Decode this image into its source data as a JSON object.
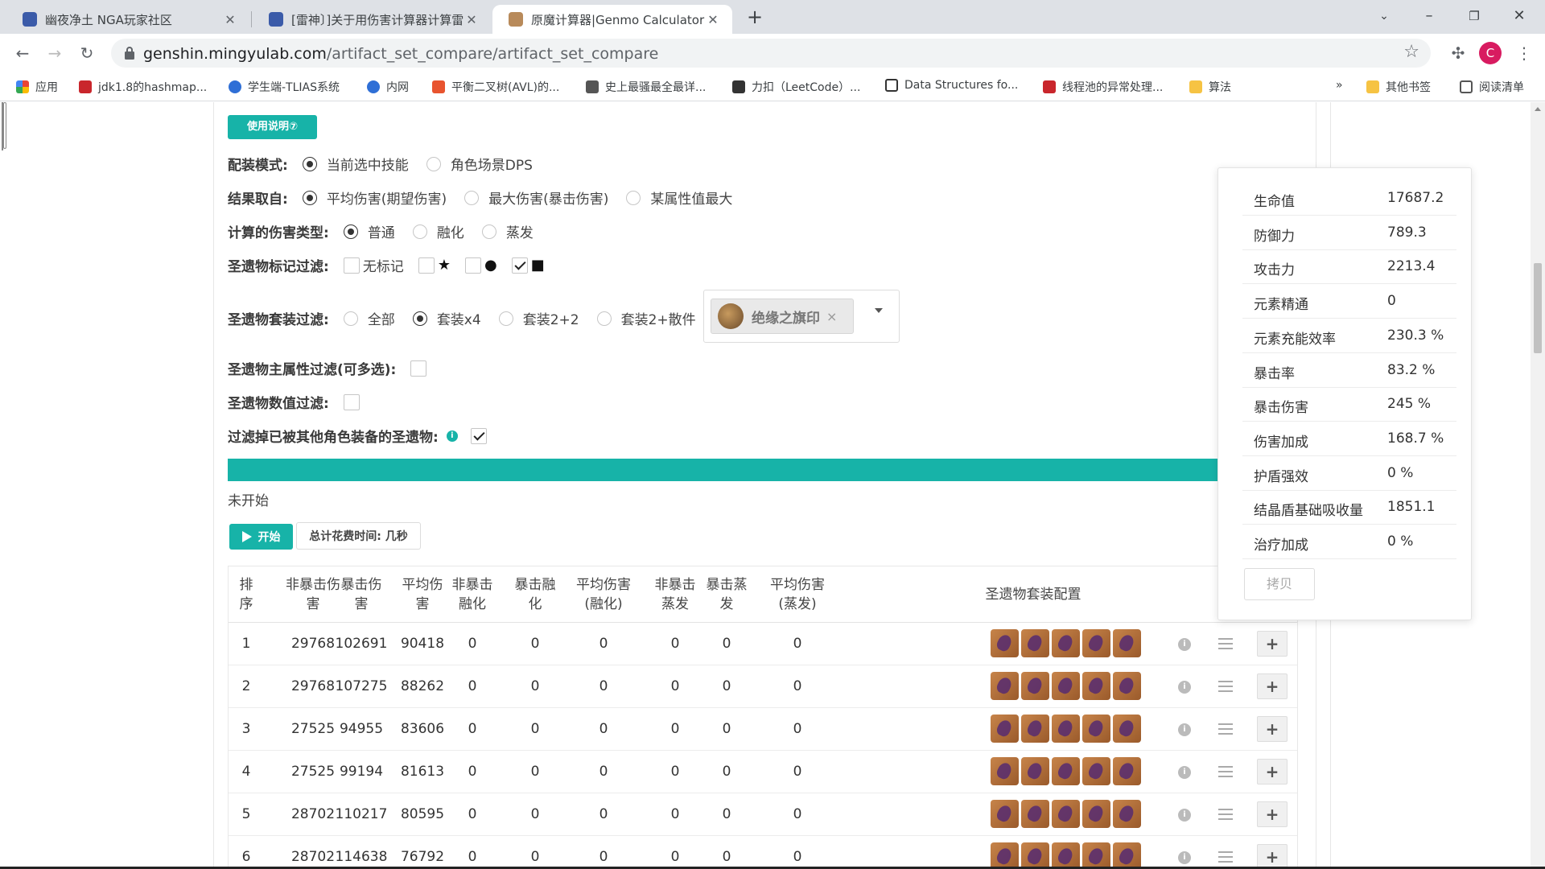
{
  "browser": {
    "tabs": [
      {
        "title": "幽夜净土 NGA玩家社区",
        "active": false
      },
      {
        "title": "[雷神〕]关于用伤害计算器计算雷",
        "active": false
      },
      {
        "title": "原魔计算器|Genmo Calculator|G",
        "active": true
      }
    ],
    "url_host": "genshin.mingyulab.com",
    "url_path": "/artifact_set_compare/artifact_set_compare",
    "avatar_letter": "C",
    "bookmarks": [
      {
        "label": "应用"
      },
      {
        "label": "jdk1.8的hashmap..."
      },
      {
        "label": "学生端-TLIAS系统"
      },
      {
        "label": "内网"
      },
      {
        "label": "平衡二叉树(AVL)的..."
      },
      {
        "label": "史上最骚最全最详..."
      },
      {
        "label": "力扣（LeetCode）..."
      },
      {
        "label": "Data Structures fo..."
      },
      {
        "label": "线程池的异常处理..."
      },
      {
        "label": "算法"
      },
      {
        "label": "»"
      },
      {
        "label": "其他书签"
      },
      {
        "label": "阅读清单"
      }
    ]
  },
  "page": {
    "help_button": "使用说明⑦",
    "mode": {
      "label": "配装模式:",
      "options": [
        "当前选中技能",
        "角色场景DPS"
      ],
      "selected": 0
    },
    "result_from": {
      "label": "结果取自:",
      "options": [
        "平均伤害(期望伤害)",
        "最大伤害(暴击伤害)",
        "某属性值最大"
      ],
      "selected": 0
    },
    "damage_type": {
      "label": "计算的伤害类型:",
      "options": [
        "普通",
        "融化",
        "蒸发"
      ],
      "selected": 0
    },
    "mark_filter": {
      "label": "圣遗物标记过滤:",
      "options": [
        "无标记",
        "★",
        "●",
        "■"
      ],
      "checked": [
        false,
        false,
        false,
        true
      ]
    },
    "set_filter": {
      "label": "圣遗物套装过滤:",
      "options": [
        "全部",
        "套装x4",
        "套装2+2",
        "套装2+散件"
      ],
      "selected": 1,
      "selected_set": "绝缘之旗印",
      "remove_glyph": "×"
    },
    "main_stat_filter": {
      "label": "圣遗物主属性过滤(可多选):"
    },
    "value_filter": {
      "label": "圣遗物数值过滤:"
    },
    "equipped_filter": {
      "label": "过滤掉已被其他角色装备的圣遗物:",
      "info": "i",
      "checked": true
    },
    "progress": 1.0,
    "status": "未开始",
    "start_button": "开始",
    "time_button": "总计花费时间: 几秒"
  },
  "table": {
    "headers": [
      "排\n序",
      "非暴击伤\n害",
      "暴击伤\n害",
      "平均伤\n害",
      "非暴击\n融化",
      "暴击融\n化",
      "平均伤害\n(融化)",
      "非暴击\n蒸发",
      "暴击蒸\n发",
      "平均伤害\n(蒸发)",
      "圣遗物套装配置"
    ],
    "rows": [
      [
        "1",
        "29768",
        "102691",
        "90418",
        "0",
        "0",
        "0",
        "0",
        "0",
        "0"
      ],
      [
        "2",
        "29768",
        "107275",
        "88262",
        "0",
        "0",
        "0",
        "0",
        "0",
        "0"
      ],
      [
        "3",
        "27525",
        "94955",
        "83606",
        "0",
        "0",
        "0",
        "0",
        "0",
        "0"
      ],
      [
        "4",
        "27525",
        "99194",
        "81613",
        "0",
        "0",
        "0",
        "0",
        "0",
        "0"
      ],
      [
        "5",
        "28702",
        "110217",
        "80595",
        "0",
        "0",
        "0",
        "0",
        "0",
        "0"
      ],
      [
        "6",
        "28702",
        "114638",
        "76792",
        "0",
        "0",
        "0",
        "0",
        "0",
        "0"
      ]
    ],
    "row_info_glyph": "i",
    "row_add_glyph": "+"
  },
  "stats": {
    "rows": [
      {
        "k": "生命值",
        "v": "17687.2"
      },
      {
        "k": "防御力",
        "v": "789.3"
      },
      {
        "k": "攻击力",
        "v": "2213.4"
      },
      {
        "k": "元素精通",
        "v": "0"
      },
      {
        "k": "元素充能效率",
        "v": "230.3 %"
      },
      {
        "k": "暴击率",
        "v": "83.2 %"
      },
      {
        "k": "暴击伤害",
        "v": "245 %"
      },
      {
        "k": "伤害加成",
        "v": "168.7 %"
      },
      {
        "k": "护盾强效",
        "v": "0 %"
      },
      {
        "k": "结晶盾基础吸收量",
        "v": "1851.1"
      },
      {
        "k": "治疗加成",
        "v": "0 %"
      }
    ],
    "copy_button": "拷贝"
  },
  "colors": {
    "accent": "#17b3a8"
  }
}
